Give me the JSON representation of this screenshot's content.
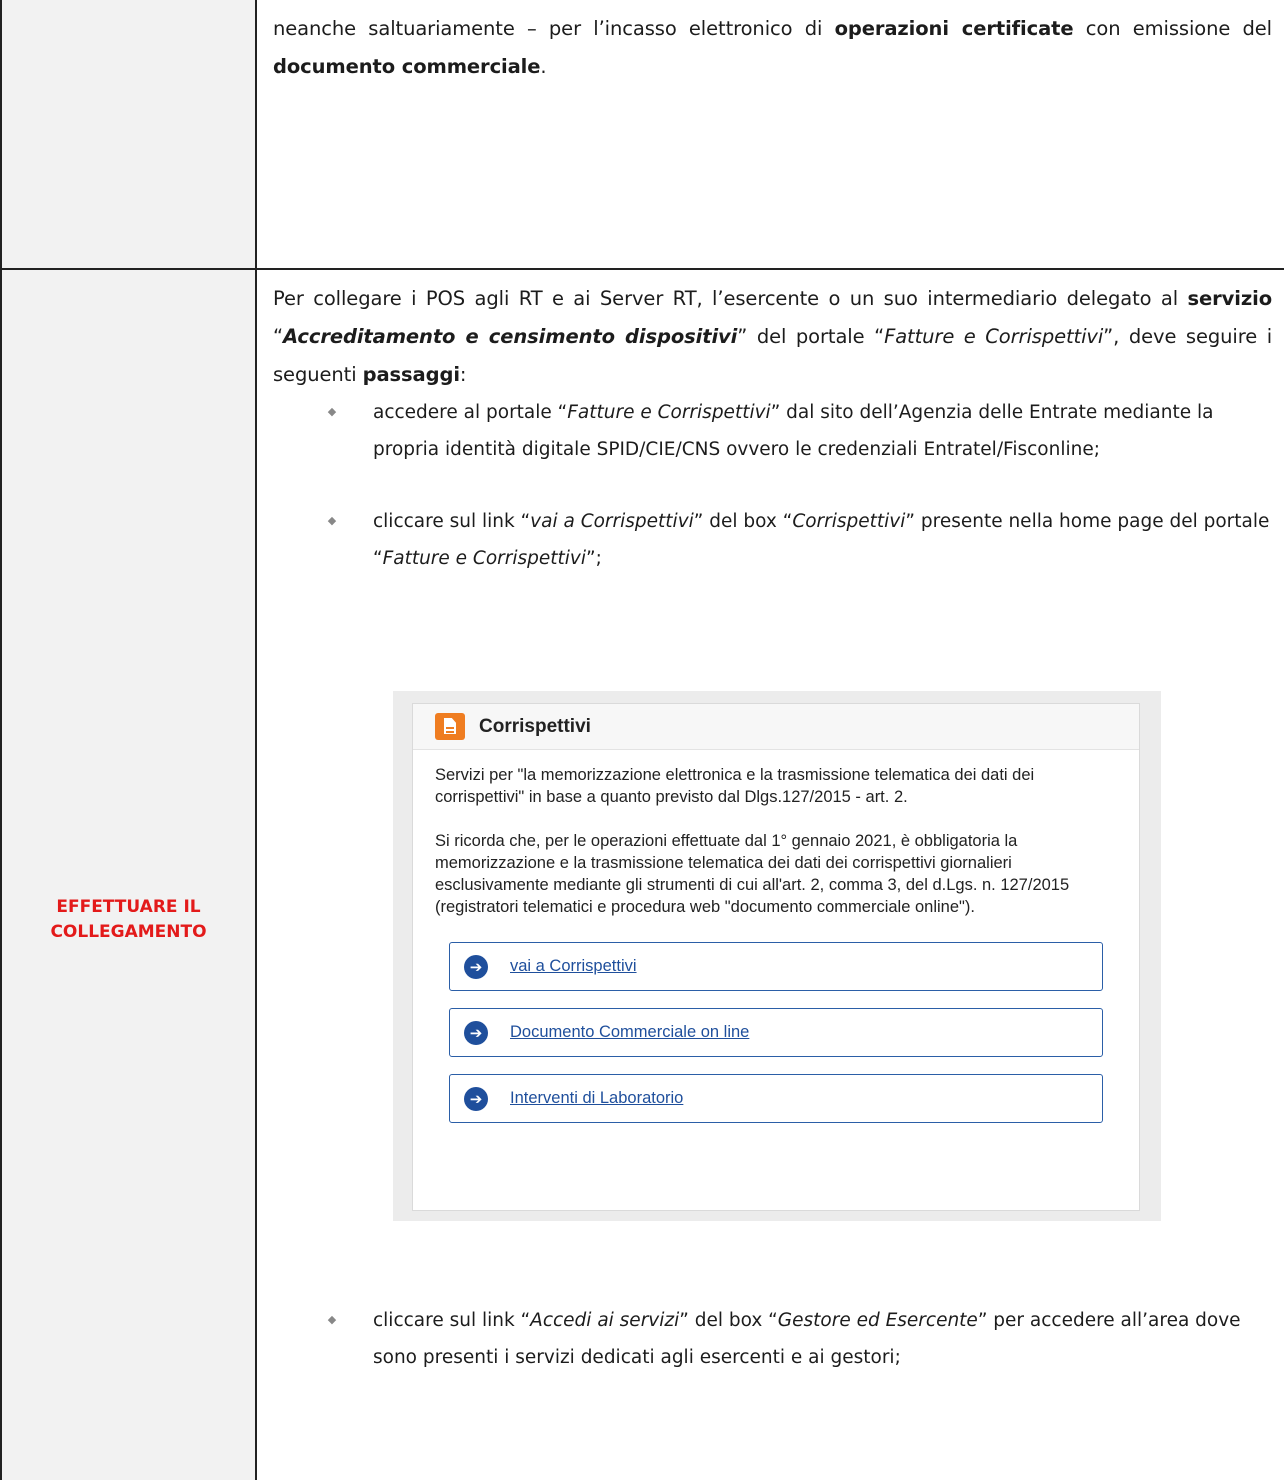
{
  "row1": {
    "text_part1": "neanche saltuariamente – per l’incasso elettronico di ",
    "bold1": "operazioni certificate",
    "text_part2": " con emissione del ",
    "bold2": "documento commerciale",
    "text_part3": "."
  },
  "row2": {
    "section_label_line1": "EFFETTUARE IL",
    "section_label_line2": "COLLEGAMENTO",
    "intro": {
      "t1": "Per collegare i POS agli RT e ai Server RT, l’esercente o un suo intermediario delegato al ",
      "b1": "servizio",
      "t2": " “",
      "bi1": "Accreditamento e censimento dispositivi",
      "t3": "” del portale “",
      "i1": "Fatture e Corrispettivi",
      "t4": "”, deve seguire i seguenti ",
      "b2": "passaggi",
      "t5": ":"
    },
    "bullet1": {
      "t1": "accedere al portale “",
      "i1": "Fatture e Corrispettivi",
      "t2": "” dal sito dell’Agenzia delle Entrate mediante la propria identità digitale SPID/CIE/CNS ovvero le credenziali Entratel/Fisconline;"
    },
    "bullet2": {
      "t1": "cliccare sul link “",
      "i1": "vai a Corrispettivi",
      "t2": "” del box “",
      "i2": "Corrispettivi",
      "t3": "” presente nella home page del portale “",
      "i3": "Fatture e Corrispettivi",
      "t4": "”;"
    },
    "portal": {
      "title": "Corrispettivi",
      "para1": "Servizi per \"la memorizzazione elettronica e la trasmissione telematica dei dati dei corrispettivi\" in base a quanto previsto dal Dlgs.127/2015 - art. 2.",
      "para2": "Si ricorda che, per le operazioni effettuate dal 1° gennaio 2021, è obbligatoria la memorizzazione e la trasmissione telematica dei dati dei corrispettivi giornalieri esclusivamente mediante gli strumenti di cui all'art. 2, comma 3, del d.Lgs. n. 127/2015 (registratori telematici e procedura web \"documento commerciale online\").",
      "links": [
        "vai a Corrispettivi",
        "Documento Commerciale on line",
        "Interventi di Laboratorio"
      ]
    },
    "bullet3": {
      "t1": "cliccare sul link “",
      "i1": "Accedi ai servizi",
      "t2": "” del box “",
      "i2": "Gestore ed Esercente",
      "t3": "” per accedere all’area dove sono presenti i servizi dedicati agli esercenti e ai gestori;"
    },
    "icons": {
      "bullet": "diamond-bullet-icon",
      "doc": "document-icon",
      "arrow": "arrow-circle-right-icon"
    },
    "colors": {
      "section_label": "#e31a1a",
      "portal_icon": "#ef7d21",
      "link": "#1f4f9c"
    }
  }
}
